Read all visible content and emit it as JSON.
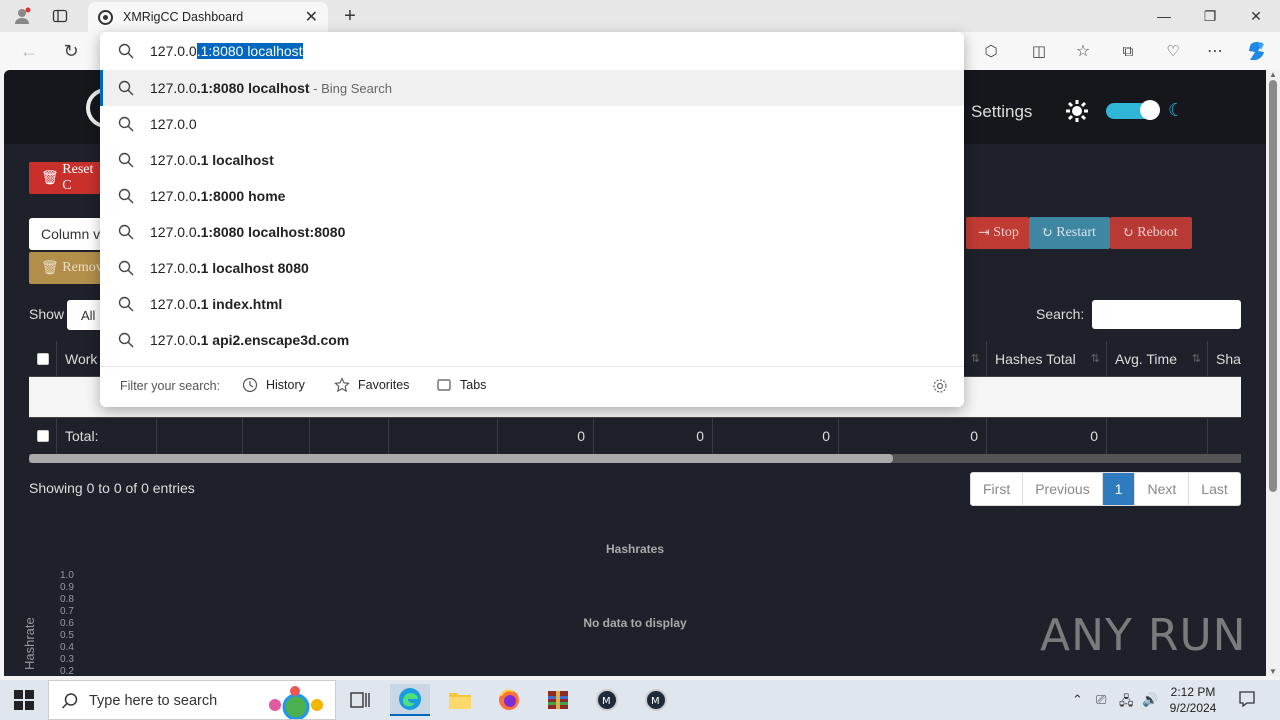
{
  "browser": {
    "tab_title": "XMRigCC Dashboard",
    "address_typed": "127.0.0",
    "address_autocomplete": ".1:8080 localhost",
    "suggestions": [
      {
        "prefix": "127.0.0",
        "bold": ".1:8080 localhost",
        "suffix": " - Bing Search"
      },
      {
        "prefix": "127.0.0",
        "bold": "",
        "suffix": ""
      },
      {
        "prefix": "127.0.0",
        "bold": ".1 localhost",
        "suffix": ""
      },
      {
        "prefix": "127.0.0",
        "bold": ".1:8000 home",
        "suffix": ""
      },
      {
        "prefix": "127.0.0",
        "bold": ".1:8080 localhost:8080",
        "suffix": ""
      },
      {
        "prefix": "127.0.0",
        "bold": ".1 localhost 8080",
        "suffix": ""
      },
      {
        "prefix": "127.0.0",
        "bold": ".1 index.html",
        "suffix": ""
      },
      {
        "prefix": "127.0.0",
        "bold": ".1 api2.enscape3d.com",
        "suffix": ""
      }
    ],
    "filter_label": "Filter your search:",
    "filter_history": "History",
    "filter_favorites": "Favorites",
    "filter_tabs": "Tabs"
  },
  "dashboard": {
    "settings_label": "Settings",
    "reset_label": "Reset C",
    "column_vis_label": "Column v",
    "remove_label": "Remov",
    "stop_label": "Stop",
    "restart_label": "Restart",
    "reboot_label": "Reboot",
    "show_label": "Show",
    "show_value": "All",
    "search_label": "Search:",
    "columns": {
      "worker": "Work",
      "hashes_total": "Hashes Total",
      "avg_time": "Avg. Time",
      "shares": "Sha"
    },
    "total_label": "Total:",
    "totals": [
      "0",
      "0",
      "0",
      "0",
      "0"
    ],
    "entries_info": "Showing 0 to 0 of 0 entries",
    "pager": {
      "first": "First",
      "previous": "Previous",
      "current": "1",
      "next": "Next",
      "last": "Last"
    },
    "chart_title": "Hashrates",
    "no_data": "No data to display",
    "y_axis_label": "Hashrate",
    "y_ticks": [
      "1.0",
      "0.9",
      "0.8",
      "0.7",
      "0.6",
      "0.5",
      "0.4",
      "0.3",
      "0.2"
    ],
    "watermark": "ANY RUN"
  },
  "taskbar": {
    "search_placeholder": "Type here to search",
    "time": "2:12 PM",
    "date": "9/2/2024"
  }
}
